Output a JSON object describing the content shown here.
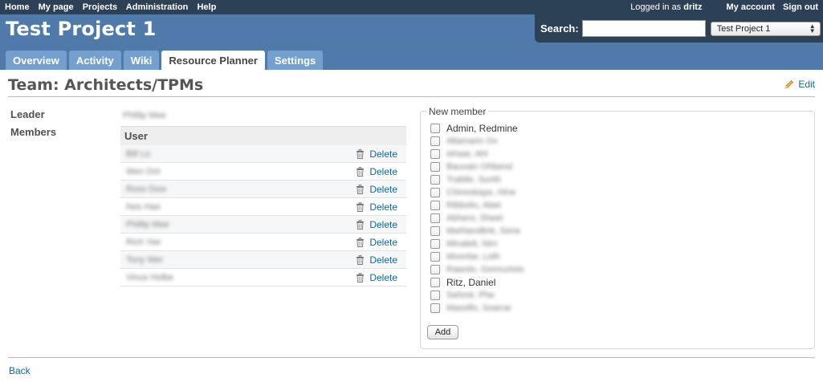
{
  "top_menu": {
    "left": [
      "Home",
      "My page",
      "Projects",
      "Administration",
      "Help"
    ],
    "logged_in_prefix": "Logged in as",
    "logged_in_user": "dritz",
    "my_account": "My account",
    "sign_out": "Sign out"
  },
  "header": {
    "project_title": "Test Project 1",
    "search_label": "Search:",
    "search_value": "",
    "project_jump": "Test Project 1"
  },
  "tabs": [
    {
      "label": "Overview",
      "selected": false
    },
    {
      "label": "Activity",
      "selected": false
    },
    {
      "label": "Wiki",
      "selected": false
    },
    {
      "label": "Resource Planner",
      "selected": true
    },
    {
      "label": "Settings",
      "selected": false
    }
  ],
  "page": {
    "title": "Team: Architects/TPMs",
    "edit_label": "Edit",
    "leader_label": "Leader",
    "leader_value": "Phillip Mee",
    "members_label": "Members",
    "members_header": "User",
    "delete_label": "Delete",
    "members": [
      "Bill Lo",
      "Wen Dot",
      "Ross Dow",
      "Nes Hao",
      "Phillip Mee",
      "Rich Yee",
      "Tony Wer",
      "Vince Holbe"
    ],
    "new_member_legend": "New member",
    "candidates": [
      "Admin, Redmine",
      "Altamarin Ov",
      "Ishaar, Ahl",
      "Bauvain Ohbend",
      "Trabile, Sunth",
      "Chinoskaye, Hine",
      "Ribboliu, Abet",
      "Abhero, Sheet",
      "Mwhlandlink, Sene",
      "Minalelt, Nim",
      "Moonlar, Loth",
      "Rawolo, Gonnurlots",
      "Ritz, Daniel",
      "Sehmir, Phe",
      "Masolfo, Soarrar"
    ],
    "add_label": "Add",
    "back_label": "Back"
  },
  "colors": {
    "top_bar": "#2C4056",
    "header": "#507AAA",
    "tab": "#759FCF",
    "link": "#116699"
  }
}
